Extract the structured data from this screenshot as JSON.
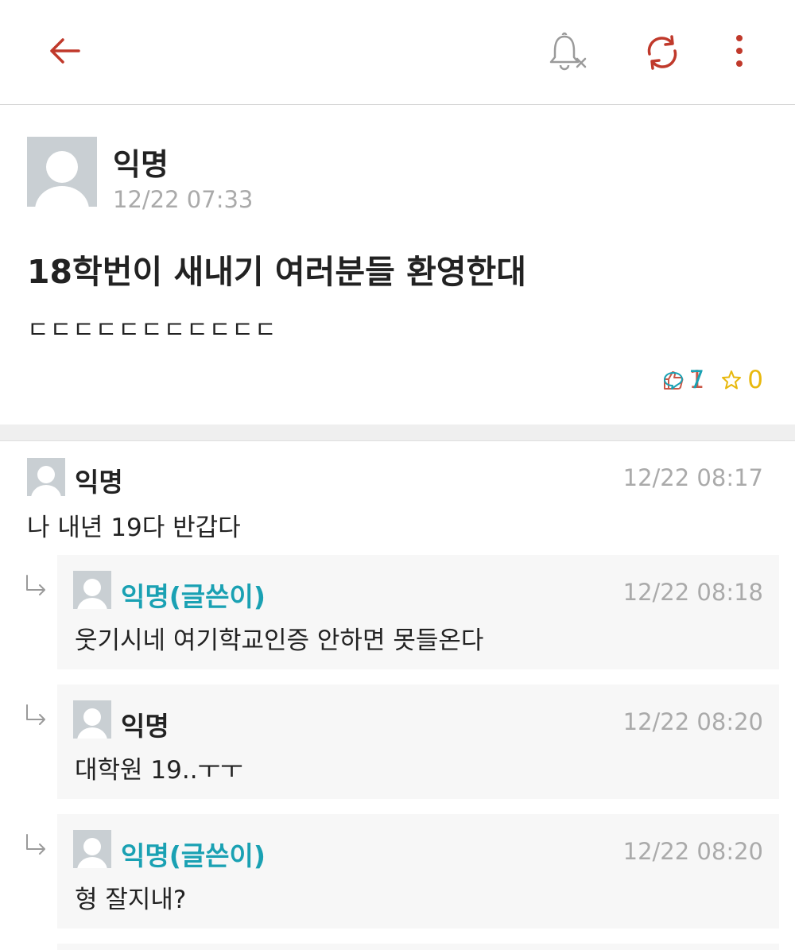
{
  "toolbar": {
    "back_icon": "arrow-left-icon",
    "bell_icon": "bell-off-icon",
    "refresh_icon": "refresh-icon",
    "more_icon": "more-vertical-icon",
    "accent_color": "#c0392b"
  },
  "post": {
    "author": "익명",
    "time": "12/22 07:33",
    "title": "18학번이 새내기 여러분들 환영한대",
    "body": "ㄷㄷㄷㄷㄷㄷㄷㄷㄷㄷㄷ",
    "likes": "1",
    "comments": "7",
    "scraps": "0"
  },
  "comments": [
    {
      "author": "익명",
      "time": "12/22 08:17",
      "text": "나 내년 19다 반갑다",
      "is_reply": false
    },
    {
      "author": "익명(글쓴이)",
      "time": "12/22 08:18",
      "text": "웃기시네 여기학교인증 안하면 못들온다",
      "is_reply": true
    },
    {
      "author": "익명",
      "time": "12/22 08:20",
      "text": "대학원 19..ㅜㅜ",
      "is_reply": true
    },
    {
      "author": "익명(글쓴이)",
      "time": "12/22 08:20",
      "text": "형 잘지내?",
      "is_reply": true
    }
  ]
}
